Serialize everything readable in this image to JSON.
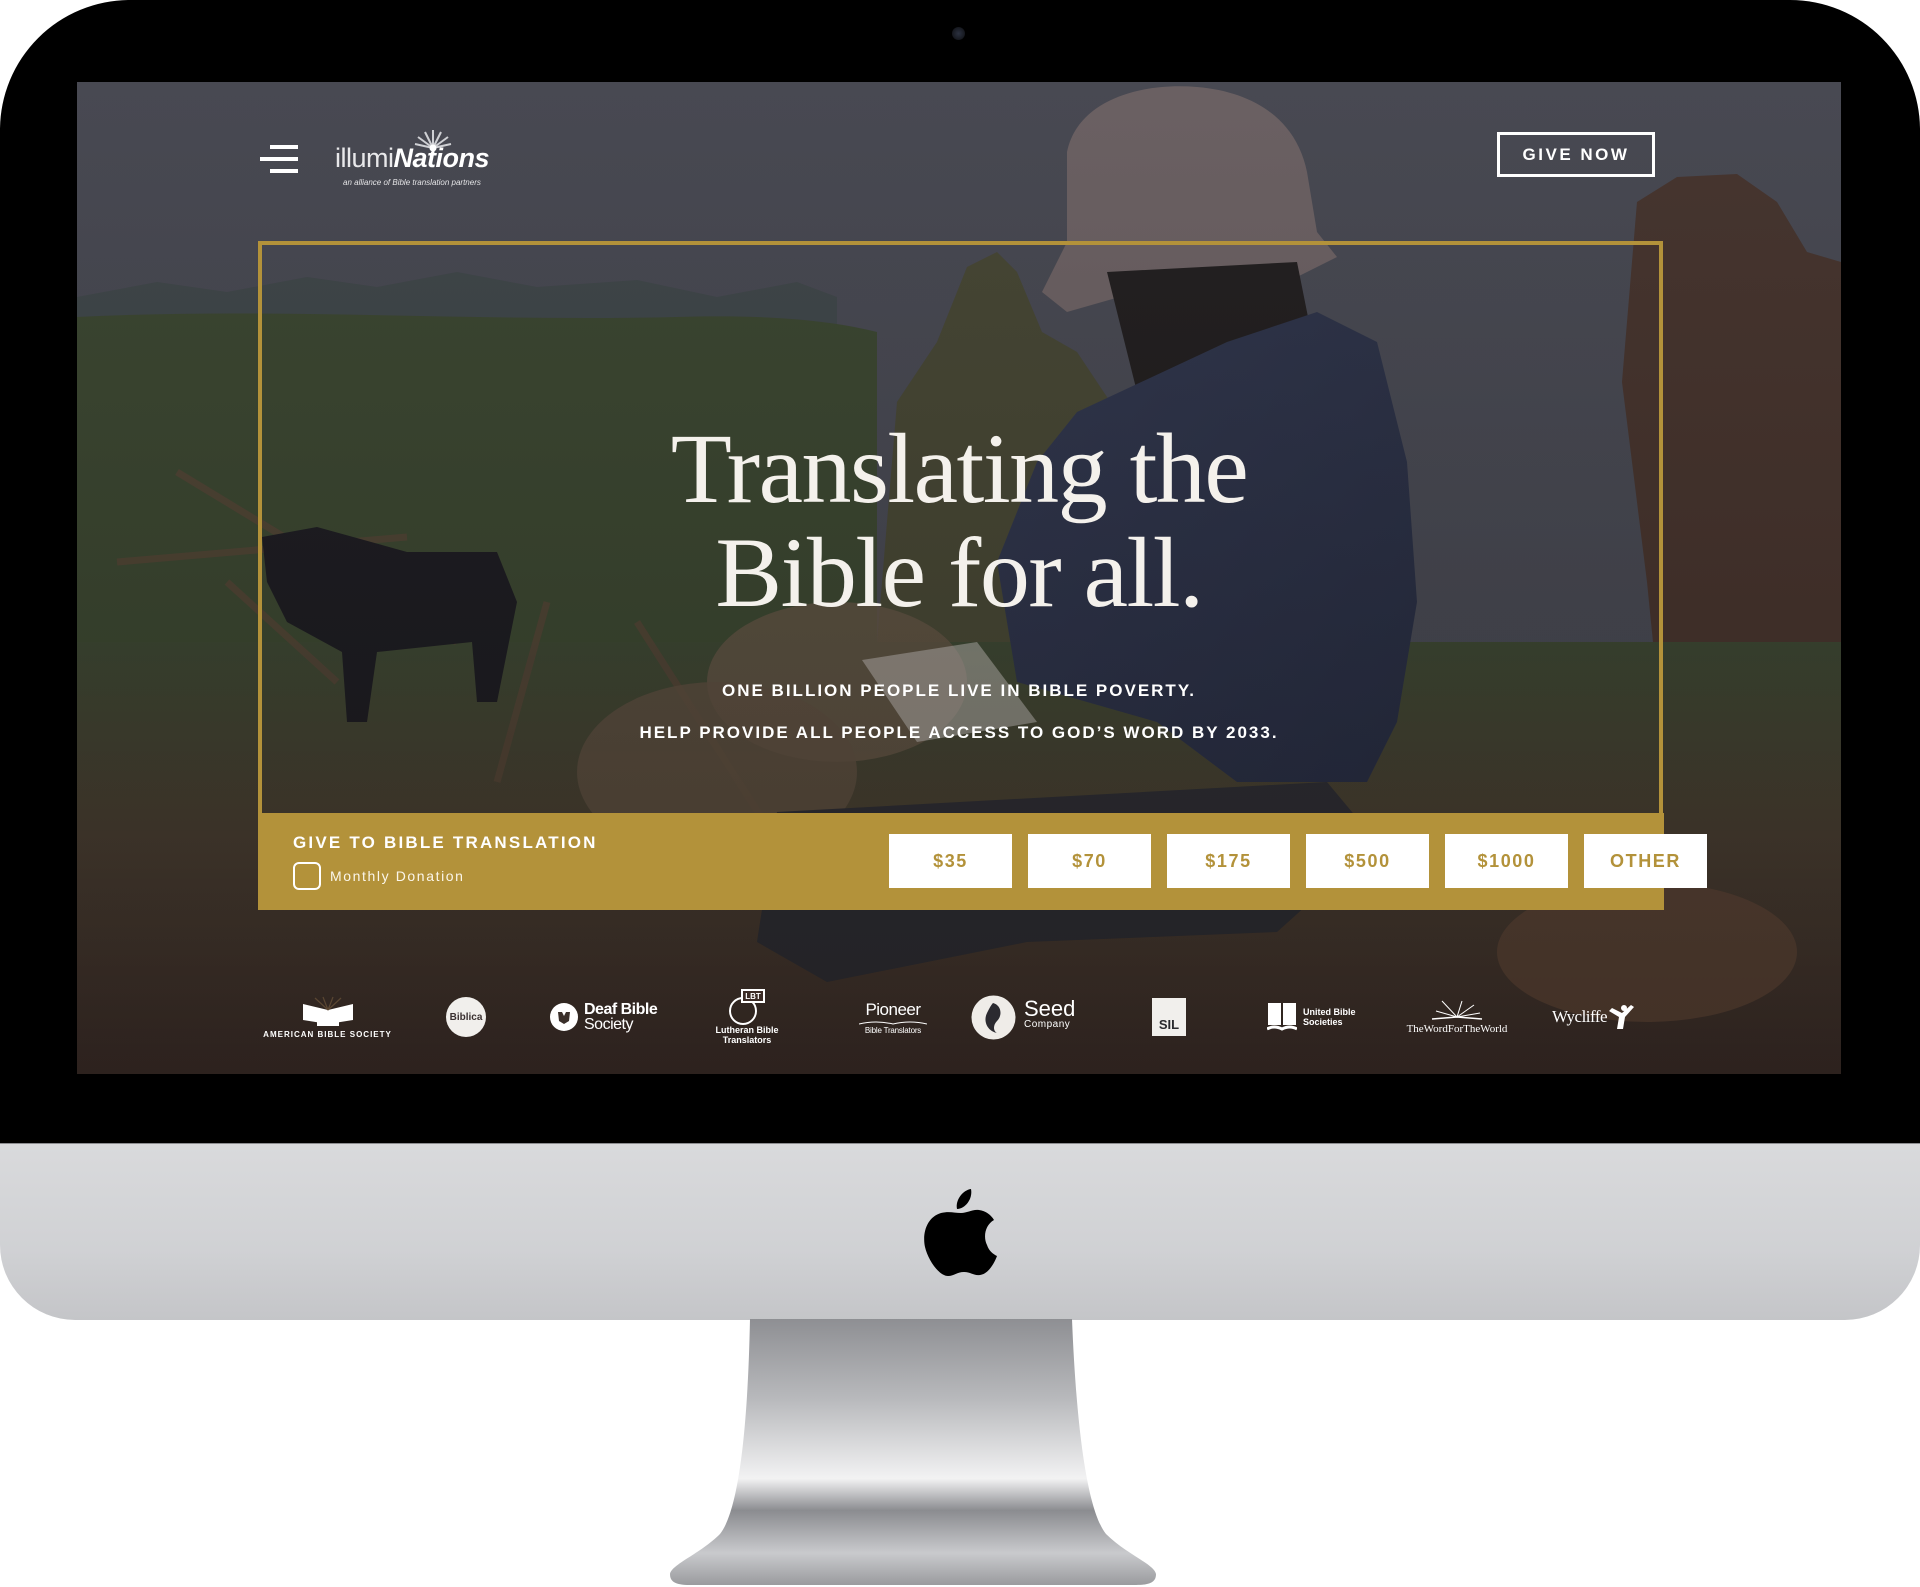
{
  "device": {
    "type": "desktop monitor mockup",
    "brand_icon": "apple-logo-icon"
  },
  "header": {
    "menu_icon": "hamburger-menu-icon",
    "logo": {
      "light_part": "illumi",
      "bold_part": "Nations",
      "tagline": "an alliance of Bible translation partners"
    },
    "give_now_label": "GIVE NOW"
  },
  "hero": {
    "headline_line1": "Translating the",
    "headline_line2": "Bible for all.",
    "subtext_line1": "ONE BILLION PEOPLE LIVE IN BIBLE POVERTY.",
    "subtext_line2": "HELP PROVIDE ALL PEOPLE ACCESS TO GOD’S WORD BY 2033."
  },
  "give_bar": {
    "title": "GIVE TO BIBLE TRANSLATION",
    "monthly_label": "Monthly Donation",
    "monthly_checked": false,
    "amounts": [
      "$35",
      "$70",
      "$175",
      "$500",
      "$1000",
      "OTHER"
    ]
  },
  "partners": [
    {
      "name": "American Bible Society",
      "label": "AMERICAN BIBLE SOCIETY"
    },
    {
      "name": "Biblica",
      "label": "Biblica"
    },
    {
      "name": "Deaf Bible Society",
      "label_line1": "Deaf Bible",
      "label_line2": "Society"
    },
    {
      "name": "Lutheran Bible Translators",
      "badge": "LBT",
      "label_line1": "Lutheran Bible",
      "label_line2": "Translators"
    },
    {
      "name": "Pioneer Bible Translators",
      "label_line1": "Pioneer",
      "label_line2": "Bible Translators"
    },
    {
      "name": "Seed Company",
      "label_line1": "Seed",
      "label_line2": "Company"
    },
    {
      "name": "SIL",
      "label": "SIL"
    },
    {
      "name": "United Bible Societies",
      "label_line1": "United Bible",
      "label_line2": "Societies"
    },
    {
      "name": "The Word For The World",
      "label": "TheWordForTheWorld"
    },
    {
      "name": "Wycliffe",
      "label": "Wycliffe"
    }
  ],
  "colors": {
    "accent_gold": "#b3923a",
    "overlay": "#4b4c55",
    "bezel": "#000000",
    "text_light": "#f4f1ec"
  }
}
